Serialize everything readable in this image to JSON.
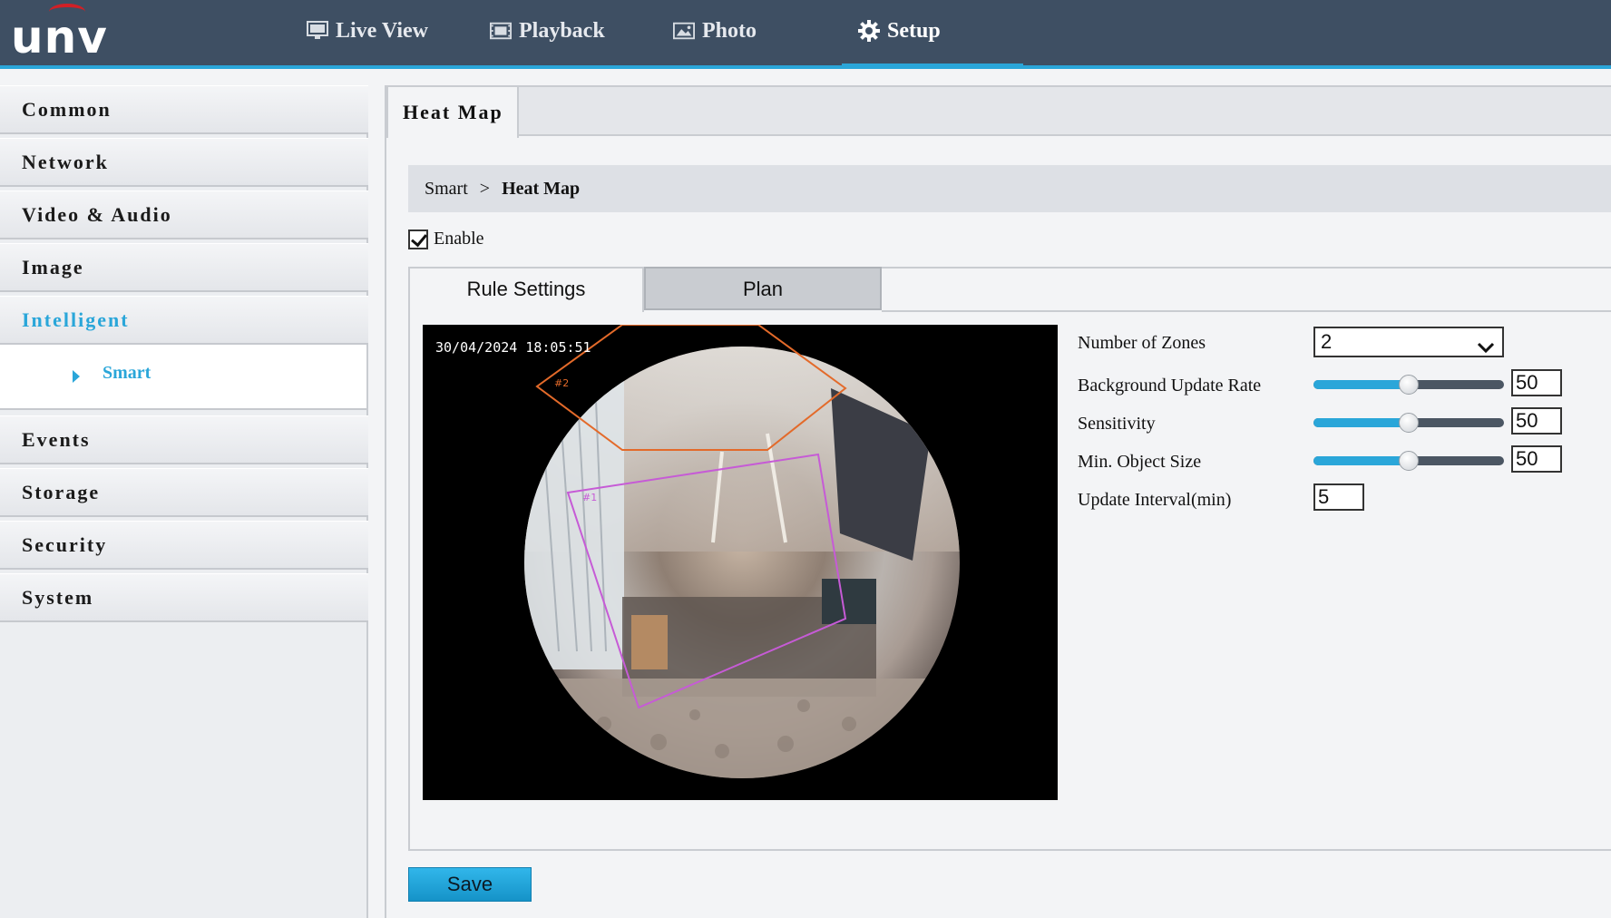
{
  "brand": {
    "logo_text": "UNV",
    "accent": "#2aa6d9",
    "topbar_bg": "#3e4f63"
  },
  "nav": [
    {
      "label": "Live View",
      "icon": "monitor-icon"
    },
    {
      "label": "Playback",
      "icon": "film-icon"
    },
    {
      "label": "Photo",
      "icon": "photo-icon"
    },
    {
      "label": "Setup",
      "icon": "gear-icon",
      "active": true
    }
  ],
  "sidebar": {
    "items": [
      {
        "label": "Common"
      },
      {
        "label": "Network"
      },
      {
        "label": "Video & Audio"
      },
      {
        "label": "Image"
      },
      {
        "label": "Intelligent",
        "active": true
      },
      {
        "label": "Events"
      },
      {
        "label": "Storage"
      },
      {
        "label": "Security"
      },
      {
        "label": "System"
      }
    ],
    "sub_item": {
      "label": "Smart"
    }
  },
  "main": {
    "tab": "Heat Map",
    "breadcrumb": {
      "parent": "Smart",
      "separator": ">",
      "current": "Heat Map"
    },
    "enable": {
      "label": "Enable",
      "checked": true
    },
    "subtabs": [
      "Rule Settings",
      "Plan"
    ],
    "video": {
      "timestamp": "30/04/2024 18:05:51",
      "zones": [
        "#2",
        "#1"
      ]
    },
    "settings": {
      "zones": {
        "label": "Number of Zones",
        "value": "2"
      },
      "bg_rate": {
        "label": "Background Update Rate",
        "value": "50",
        "level": 0.5
      },
      "sensitivity": {
        "label": "Sensitivity",
        "value": "50",
        "level": 0.5
      },
      "min_size": {
        "label": "Min. Object Size",
        "value": "50",
        "level": 0.5
      },
      "interval": {
        "label": "Update Interval(min)",
        "value": "5"
      }
    },
    "save_label": "Save"
  }
}
